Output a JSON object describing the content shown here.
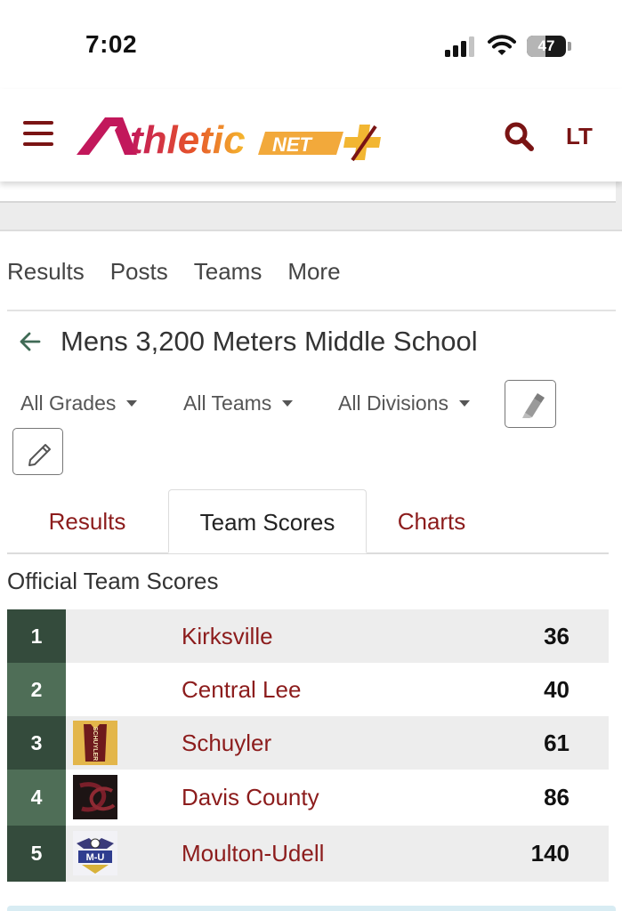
{
  "status_bar": {
    "time": "7:02",
    "battery_level": "47",
    "battery_fraction": 0.47,
    "signal_bars": 3,
    "signal_total": 4
  },
  "header": {
    "logo_text_main": "thletic",
    "logo_text_net": "NET",
    "user_initials": "LT"
  },
  "top_nav": {
    "items": [
      "Results",
      "Posts",
      "Teams",
      "More"
    ]
  },
  "event": {
    "title": "Mens 3,200 Meters Middle School"
  },
  "filters": {
    "grades": "All Grades",
    "teams": "All Teams",
    "divisions": "All Divisions"
  },
  "tabs": {
    "results": "Results",
    "team_scores": "Team Scores",
    "charts": "Charts",
    "active": "team_scores"
  },
  "section": {
    "title": "Official Team Scores"
  },
  "scores": [
    {
      "rank": "1",
      "team": "Kirksville",
      "points": "36",
      "logo": "none"
    },
    {
      "rank": "2",
      "team": "Central Lee",
      "points": "40",
      "logo": "none"
    },
    {
      "rank": "3",
      "team": "Schuyler",
      "points": "61",
      "logo": "schuyler-jersey-logo",
      "logo_text": "SCHUYLER"
    },
    {
      "rank": "4",
      "team": "Davis County",
      "points": "86",
      "logo": "davis-county-dc-logo"
    },
    {
      "rank": "5",
      "team": "Moulton-Udell",
      "points": "140",
      "logo": "moulton-udell-eagle-logo",
      "logo_text": "M-U"
    }
  ],
  "colors": {
    "brand_maroon": "#7a1414",
    "link_maroon": "#8c1c1c",
    "rank_dark": "#344b3c",
    "rank_light": "#4f6e57",
    "logo_gradient_start": "#c2185b",
    "logo_gradient_end": "#f5b82e"
  }
}
